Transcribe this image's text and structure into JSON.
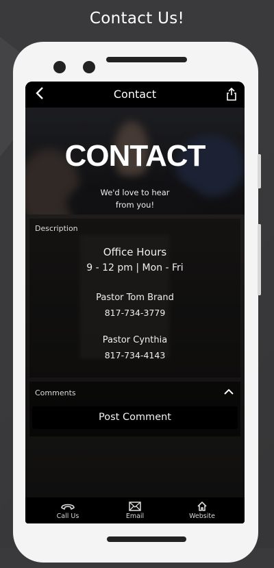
{
  "headline": "Contact Us!",
  "app": {
    "title": "Contact",
    "back_icon": "chevron-left-icon",
    "share_icon": "share-icon"
  },
  "hero": {
    "big_text": "CONTACT",
    "tagline_line1": "We'd love to hear",
    "tagline_line2": "from you!"
  },
  "description": {
    "label": "Description",
    "office_hours_title": "Office Hours",
    "office_hours": "9 - 12 pm | Mon - Fri",
    "contacts": [
      {
        "name": "Pastor Tom Brand",
        "phone": "817-734-3779"
      },
      {
        "name": "Pastor Cynthia",
        "phone": "817-734-4143"
      }
    ]
  },
  "comments": {
    "label": "Comments",
    "post_button": "Post Comment"
  },
  "tabs": [
    {
      "label": "Call Us",
      "icon": "phone-icon"
    },
    {
      "label": "Email",
      "icon": "mail-icon"
    },
    {
      "label": "Website",
      "icon": "home-icon"
    }
  ]
}
